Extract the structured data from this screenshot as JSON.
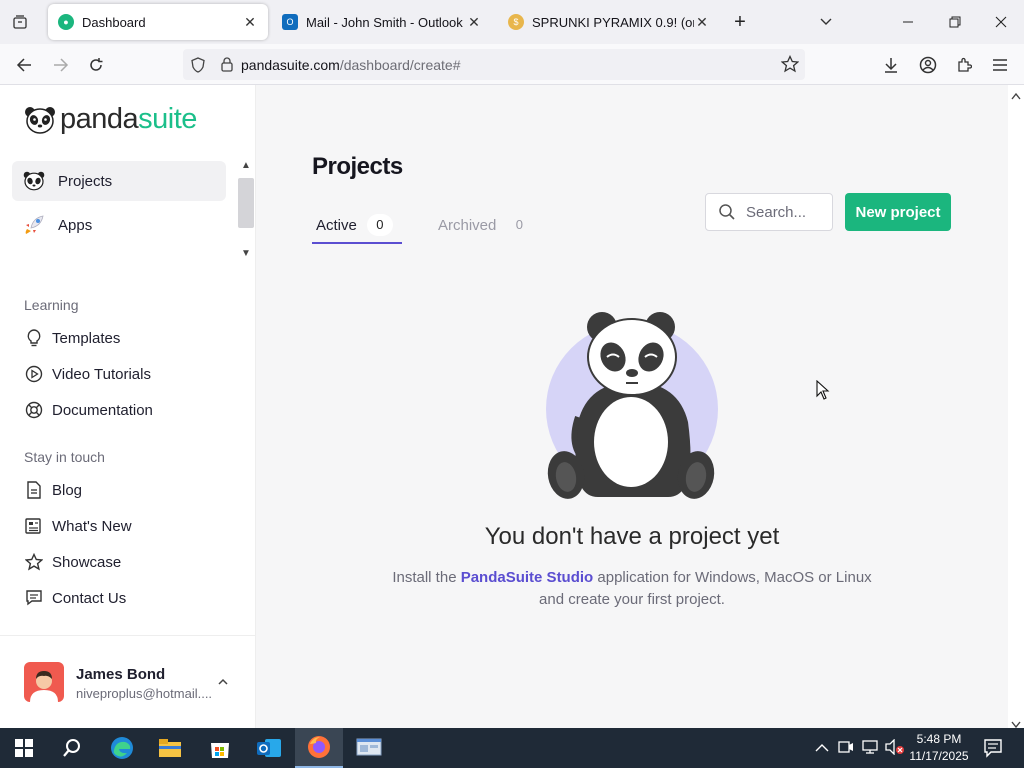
{
  "browser": {
    "tabs": [
      {
        "title": "Dashboard",
        "active": true
      },
      {
        "title": "Mail - John Smith - Outlook",
        "active": false
      },
      {
        "title": "SPRUNKI PYRAMIX 0.9! (origina",
        "active": false
      }
    ],
    "url_domain": "pandasuite.com",
    "url_path": "/dashboard/create#"
  },
  "sidebar": {
    "logo": {
      "part1": "panda",
      "part2": "suite"
    },
    "main_items": [
      {
        "label": "Projects",
        "icon": "panda-icon",
        "selected": true
      },
      {
        "label": "Apps",
        "icon": "rocket-icon",
        "selected": false
      }
    ],
    "learning": {
      "title": "Learning",
      "items": [
        {
          "label": "Templates",
          "icon": "lightbulb-icon"
        },
        {
          "label": "Video Tutorials",
          "icon": "play-circle-icon"
        },
        {
          "label": "Documentation",
          "icon": "lifebuoy-icon"
        }
      ]
    },
    "stay_in_touch": {
      "title": "Stay in touch",
      "items": [
        {
          "label": "Blog",
          "icon": "document-icon"
        },
        {
          "label": "What's New",
          "icon": "newspaper-icon"
        },
        {
          "label": "Showcase",
          "icon": "star-icon"
        },
        {
          "label": "Contact Us",
          "icon": "chat-icon"
        }
      ]
    },
    "user": {
      "name": "James Bond",
      "email": "niveproplus@hotmail...."
    }
  },
  "main": {
    "title": "Projects",
    "tabs": [
      {
        "label": "Active",
        "count": "0",
        "selected": true
      },
      {
        "label": "Archived",
        "count": "0",
        "selected": false
      }
    ],
    "search_placeholder": "Search...",
    "new_project_label": "New project",
    "empty_title": "You don't have a project yet",
    "empty_desc_before": "Install the ",
    "empty_desc_link": "PandaSuite Studio",
    "empty_desc_after": " application for Windows, MacOS or Linux and create your first project."
  },
  "taskbar": {
    "time": "5:48 PM",
    "date": "11/17/2025"
  },
  "colors": {
    "accent_green": "#1bb67e",
    "accent_purple": "#5b4ed1",
    "tab_underline": "#5b4ed1"
  }
}
